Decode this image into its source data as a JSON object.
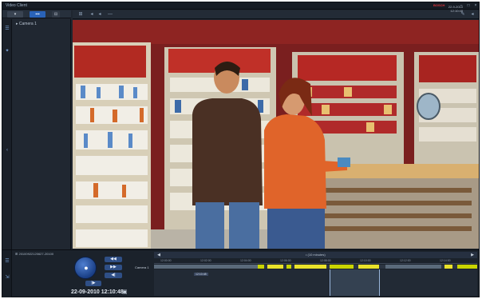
{
  "window": {
    "title": "Video Client",
    "logo": "BOSCH"
  },
  "left_panel": {
    "tabs": [
      {
        "label": "▾"
      },
      {
        "label": "▪▪▪"
      },
      {
        "label": "⊟"
      }
    ],
    "tree": {
      "item_label": "Camera 1"
    }
  },
  "toolbar": {
    "date": "22-9-2010",
    "time": "12:10:48"
  },
  "playback": {
    "file_label": "20100922120627-20100",
    "timestamp": "22-09-2010 12:10:48",
    "buttons": [
      "◀◀",
      "▶▶",
      "◀|",
      "|▶"
    ],
    "ptz_icon": "play"
  },
  "timeline": {
    "resolution_label": "• (10 minutes)",
    "camera_label": "Camera 1",
    "ticks": [
      "12:00:00",
      "12:02:00",
      "12:04:00",
      "12:06:00",
      "12:08:00",
      "12:10:00",
      "12:12:00",
      "12:14:00"
    ],
    "cursor_label": "12:10:48",
    "colors": {
      "recording": "#c9d400",
      "alarm": "#e9e22a",
      "empty": "#5a6a7a"
    }
  },
  "icons": {
    "rail_top": "tree-icon",
    "rail_mid": "pin-icon",
    "rail_bottom": "arrow-icon"
  }
}
